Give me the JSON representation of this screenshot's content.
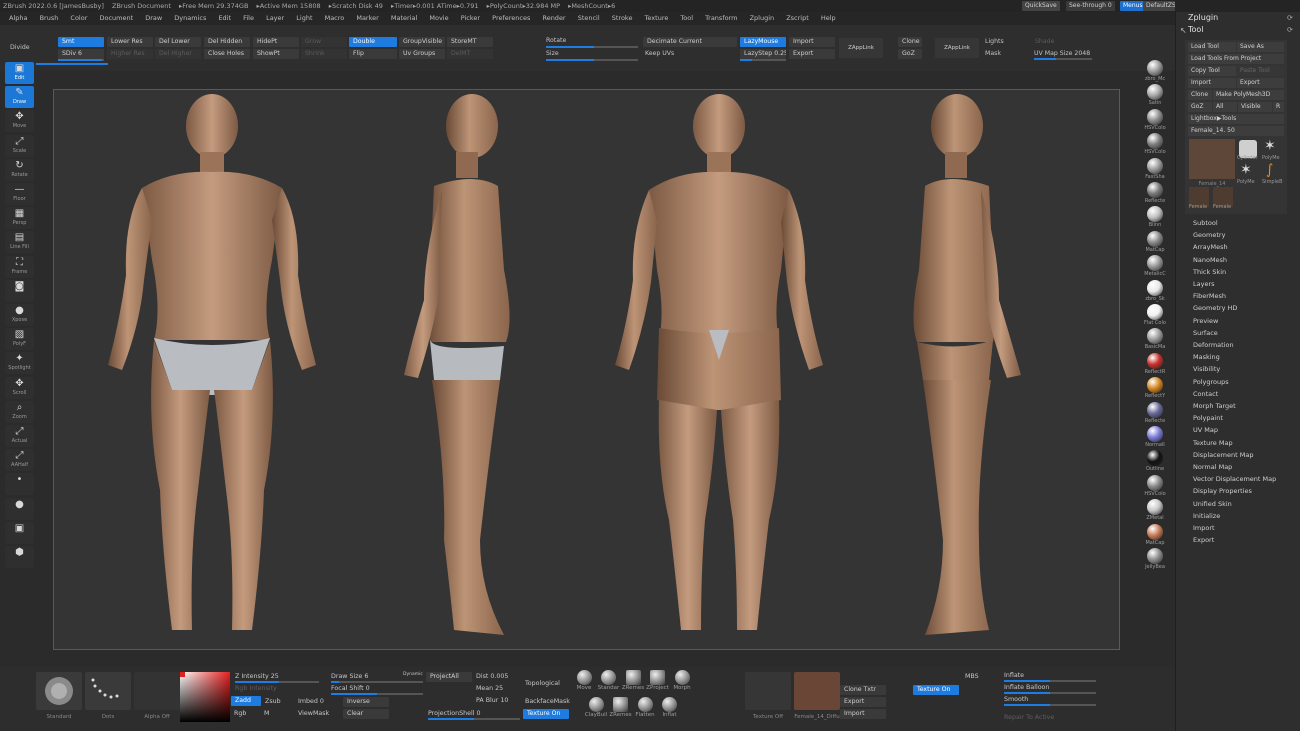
{
  "titlebar": {
    "items": [
      "ZBrush 2022.0.6 [JamesBusby]",
      "ZBrush Document",
      "▸Free Mem 29.374GB",
      "▸Active Mem 15808",
      "▸Scratch Disk 49",
      "▸Timer▸0.001 ATime▸0.791",
      "▸PolyCount▸32.984 MP",
      "▸MeshCount▸6"
    ],
    "quicksave": "QuickSave",
    "seethrough": "See-through  0",
    "menus": "Menus",
    "zscript": "DefaultZScript"
  },
  "menubar": [
    "Alpha",
    "Brush",
    "Color",
    "Document",
    "Draw",
    "Dynamics",
    "Edit",
    "File",
    "Layer",
    "Light",
    "Macro",
    "Marker",
    "Material",
    "Movie",
    "Picker",
    "Preferences",
    "Render",
    "Stencil",
    "Stroke",
    "Texture",
    "Tool",
    "Transform",
    "Zplugin",
    "Zscript",
    "Help"
  ],
  "shelf": {
    "divide": "Divide",
    "smt": "Smt",
    "sdiv": "SDiv 6",
    "lower_res": "Lower Res",
    "higher_res": "Higher Res",
    "del_lower": "Del Lower",
    "del_higher": "Del Higher",
    "del_hidden": "Del Hidden",
    "close_holes": "Close Holes",
    "hidept": "HidePt",
    "showpt": "ShowPt",
    "grow": "Grow",
    "shrink": "Shrink",
    "double": "Double",
    "flip": "Flip",
    "groupvisible": "GroupVisible",
    "uv_groups": "Uv Groups",
    "storemt": "StoreMT",
    "delmt": "DelMT",
    "rotate": "Rotate",
    "size": "Size",
    "decimate": "Decimate Current",
    "keep_uvs": "Keep UVs",
    "lazymouse": "LazyMouse",
    "lazystep": "LazyStep 0.25",
    "import": "Import",
    "export": "Export",
    "zapplink1": "ZAppLink",
    "clone": "Clone",
    "goz": "GoZ",
    "zapplink2": "ZAppLink",
    "lights": "Lights",
    "shade": "Shade",
    "mask": "Mask",
    "uvmapsize": "UV Map Size 2048"
  },
  "lefttools": [
    {
      "name": "edit",
      "label": "Edit",
      "icon": "▣"
    },
    {
      "name": "draw",
      "label": "Draw",
      "icon": "✎"
    },
    {
      "name": "move",
      "label": "Move",
      "icon": "✥"
    },
    {
      "name": "scale",
      "label": "Scale",
      "icon": "⤢"
    },
    {
      "name": "rotate",
      "label": "Rotate",
      "icon": "↻"
    },
    {
      "name": "floor",
      "label": "Floor",
      "icon": "—"
    },
    {
      "name": "persp",
      "label": "Persp",
      "icon": "▦"
    },
    {
      "name": "linefill",
      "label": "Line Fill",
      "icon": "▤"
    },
    {
      "name": "frame",
      "label": "Frame",
      "icon": "⛶"
    },
    {
      "name": "camera",
      "label": "",
      "icon": "◙"
    },
    {
      "name": "xpose",
      "label": "Xpose",
      "icon": "●"
    },
    {
      "name": "polyf",
      "label": "PolyF",
      "icon": "▧"
    },
    {
      "name": "spotlight",
      "label": "Spotlight",
      "icon": "✦"
    },
    {
      "name": "scroll",
      "label": "Scroll",
      "icon": "✥"
    },
    {
      "name": "zoom",
      "label": "Zoom",
      "icon": "⌕"
    },
    {
      "name": "actual",
      "label": "Actual",
      "icon": "⤢"
    },
    {
      "name": "aahalf",
      "label": "AAHalf",
      "icon": "⤢"
    },
    {
      "name": "transp",
      "label": "",
      "icon": "•"
    },
    {
      "name": "solo",
      "label": "",
      "icon": "●"
    },
    {
      "name": "ghost",
      "label": "",
      "icon": "▣"
    },
    {
      "name": "cube",
      "label": "",
      "icon": "⬢"
    }
  ],
  "materials": [
    {
      "label": "zbro_Mc",
      "color": "#9a9a9a"
    },
    {
      "label": "Satin",
      "color": "#a8a8a8"
    },
    {
      "label": "HSVColo",
      "color": "#8e8e8e"
    },
    {
      "label": "HSVColo",
      "color": "#7e7e7e"
    },
    {
      "label": "FastSha",
      "color": "#9b9b9b"
    },
    {
      "label": "Reflecte",
      "color": "#7a7a7a"
    },
    {
      "label": "Blinn",
      "color": "#c0c0c0"
    },
    {
      "label": "MatCap",
      "color": "#8a8a8a"
    },
    {
      "label": "MetalicC",
      "color": "#999"
    },
    {
      "label": "zbro_Sk",
      "color": "#e8e8e8"
    },
    {
      "label": "Flat Colo",
      "color": "#f2f2f2"
    },
    {
      "label": "BasicMa",
      "color": "#9d9d9d"
    },
    {
      "label": "ReflectR",
      "color": "#c8302a"
    },
    {
      "label": "ReflectY",
      "color": "#d68620"
    },
    {
      "label": "Reflecte",
      "color": "#6a6a9a"
    },
    {
      "label": "NormalI",
      "color": "#7b7bd8"
    },
    {
      "label": "Outline",
      "color": "#111111"
    },
    {
      "label": "HSVColo",
      "color": "#8a8a8a"
    },
    {
      "label": "ZMetal",
      "color": "#c8c8c8"
    },
    {
      "label": "MatCap",
      "color": "#c77a55"
    },
    {
      "label": "JellyBea",
      "color": "#8f8f8f"
    }
  ],
  "panel": {
    "zplugin": "Zplugin",
    "tool": "Tool",
    "load_tool": "Load Tool",
    "save_as": "Save As",
    "load_from_project": "Load Tools From Project",
    "copy_tool": "Copy Tool",
    "paste_tool": "Paste Tool",
    "import": "Import",
    "export": "Export",
    "clone": "Clone",
    "make_polymesh": "Make PolyMesh3D",
    "goz": "GoZ",
    "all": "All",
    "visible": "Visible",
    "r": "R",
    "lightbox": "Lightbox▶Tools",
    "current_tool": "Female_14. 50",
    "thumbs": [
      "Female_14",
      "Cylinder",
      "PolyMe",
      "PolyMe",
      "SimpleB",
      "Female",
      "Female"
    ],
    "sections": [
      "Subtool",
      "Geometry",
      "ArrayMesh",
      "NanoMesh",
      "Thick Skin",
      "Layers",
      "FiberMesh",
      "Geometry HD",
      "Preview",
      "Surface",
      "Deformation",
      "Masking",
      "Visibility",
      "Polygroups",
      "Contact",
      "Morph Target",
      "Polypaint",
      "UV Map",
      "Texture Map",
      "Displacement Map",
      "Normal Map",
      "Vector Displacement Map",
      "Display Properties",
      "Unified Skin",
      "Initialize",
      "Import",
      "Export"
    ]
  },
  "bottom": {
    "standard": "Standard",
    "dots": "Dots",
    "alpha_off": "Alpha Off",
    "z_intensity": "Z Intensity 25",
    "rgb_intensity": "Rgb Intensity",
    "zadd": "Zadd",
    "zsub": "Zsub",
    "rgb": "Rgb",
    "m": "M",
    "imbed": "Imbed 0",
    "viewmask": "ViewMask",
    "draw_size": "Draw Size 6",
    "dynamic": "Dynamic",
    "focal_shift": "Focal Shift 0",
    "inverse": "Inverse",
    "clear": "Clear",
    "projectall": "ProjectAll",
    "dist": "Dist 0.005",
    "mean": "Mean 25",
    "pablur": "PA Blur 10",
    "projectionshell": "ProjectionShell 0",
    "topological": "Topological",
    "backfacemask": "BackfaceMask",
    "texture_on": "Texture On",
    "brushes": [
      "Move",
      "Standar",
      "ZRemes",
      "ZProject",
      "Morph",
      "ClayBuil",
      "ZRemes",
      "Flatten",
      "Inflat"
    ],
    "texture_off": "Texture Off",
    "texture_name": "Female_14_Diffu",
    "clone_txtr": "Clone Txtr",
    "export": "Export",
    "import": "Import",
    "texture_on2": "Texture On",
    "mbs": "MBS",
    "inflate": "Inflate",
    "inflate_balloon": "Inflate Balloon",
    "smooth": "Smooth",
    "repair": "Repair To Active"
  }
}
